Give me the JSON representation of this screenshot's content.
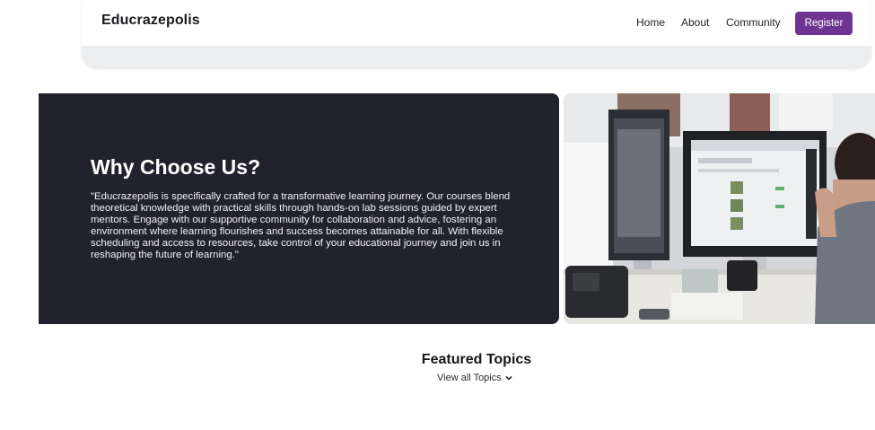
{
  "header": {
    "logo": "Educrazepolis",
    "nav": [
      {
        "label": "Home"
      },
      {
        "label": "About"
      },
      {
        "label": "Community"
      }
    ],
    "register_label": "Register",
    "accent_color": "#6d3492"
  },
  "why": {
    "title": "Why Choose Us?",
    "text": "\"Educrazepolis is specifically crafted for a transformative learning journey. Our courses blend theoretical knowledge with practical skills through hands-on lab sessions guided by expert mentors. Engage with our supportive community for collaboration and advice, fostering an environment where learning flourishes and success becomes attainable for all. With flexible scheduling and access to resources, take control of your educational journey and join us in reshaping the future of learning.\"",
    "card_color": "#22222f"
  },
  "featured": {
    "title": "Featured Topics",
    "view_all": "View all Topics",
    "view_all_icon": "chevron-down-icon"
  }
}
